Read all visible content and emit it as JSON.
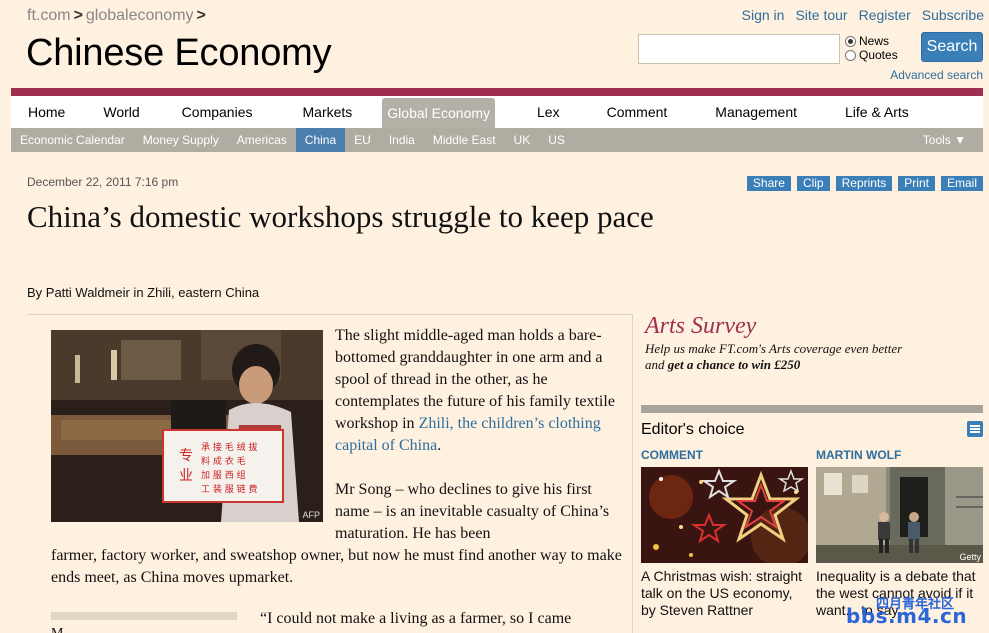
{
  "breadcrumb": {
    "site": "ft.com",
    "section": "globaleconomy"
  },
  "masthead": "Chinese Economy",
  "toplinks": [
    "Sign in",
    "Site tour",
    "Register",
    "Subscribe"
  ],
  "search": {
    "placeholder": "",
    "options": [
      "News",
      "Quotes"
    ],
    "selected": "News",
    "button": "Search",
    "advanced": "Advanced search"
  },
  "nav": [
    "Home",
    "World",
    "Companies",
    "Markets",
    "Global Economy",
    "Lex",
    "Comment",
    "Management",
    "Life & Arts"
  ],
  "nav_active": "Global Economy",
  "subnav": [
    "Economic Calendar",
    "Money Supply",
    "Americas",
    "China",
    "EU",
    "India",
    "Middle East",
    "UK",
    "US"
  ],
  "subnav_active": "China",
  "tools": "Tools ▼",
  "article": {
    "date": "December 22, 2011 7:16 pm",
    "actions": [
      "Share",
      "Clip",
      "Reprints",
      "Print",
      "Email"
    ],
    "headline": "China’s domestic workshops struggle to keep pace",
    "byline": "By Patti Waldmeir in Zhili, eastern China",
    "photo_credit": "AFP",
    "p1_text": "The slight middle-aged man holds a bare-bottomed granddaughter in one arm and a spool of thread in the other, as he contemplates the future of his family textile workshop in ",
    "p1_link": "Zhili, the children’s clothing capital of China",
    "p1_end": ".",
    "p2a": "Mr Song – who declines to give his first name – is an inevitable casualty of China’s maturation. He has been",
    "p2b": "farmer, factory worker, and sweatshop owner, but now he must find another way to make ends meet, as China moves upmarket.",
    "p3": "“I could not make a living as a farmer, so I came",
    "p4_start": "M"
  },
  "arts": {
    "title": "Arts Survey",
    "line1": "Help us make FT.com's Arts coverage even better",
    "line2_a": "and ",
    "line2_b": "get a chance to win £250"
  },
  "editors_choice": {
    "title": "Editor's choice",
    "items": [
      {
        "label": "COMMENT",
        "caption": "A Christmas wish: straight talk on the US economy, by Steven Rattner"
      },
      {
        "label": "MARTIN WOLF",
        "caption": "Inequality is a debate that the west cannot avoid if it want... to say ...",
        "credit": "Getty"
      }
    ]
  },
  "watermark": {
    "domain": "bbs.m4.cn",
    "cn": "四月青年社区"
  }
}
